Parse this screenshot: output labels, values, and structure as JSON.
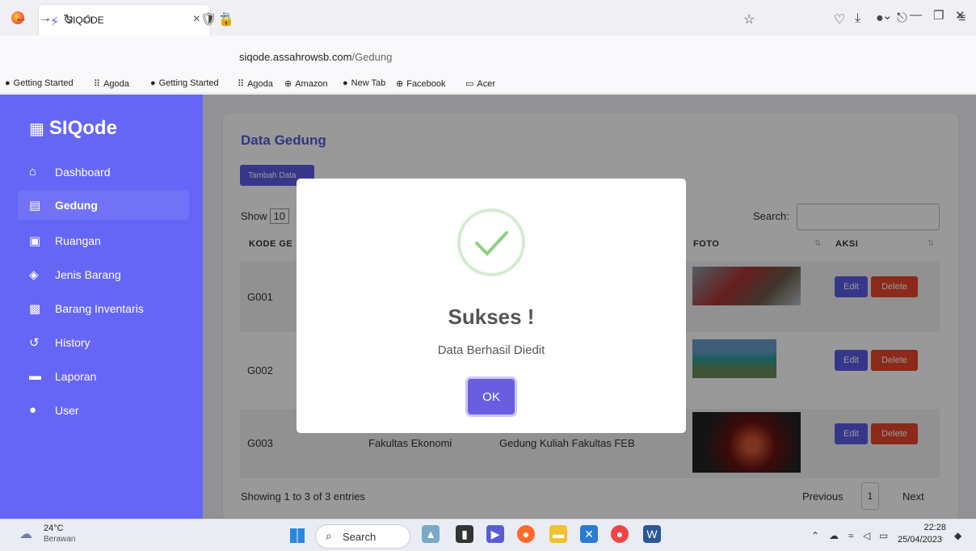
{
  "browser": {
    "tab_title": "SIQODE",
    "tab_close": "×",
    "new_tab": "+",
    "url_host": "siqode.assahrowsb.com",
    "url_path": "/Gedung",
    "bookmarks": [
      "Getting Started",
      "Agoda",
      "Getting Started",
      "Agoda",
      "Amazon",
      "New Tab",
      "Facebook",
      "Acer"
    ]
  },
  "sidebar": {
    "brand": "SIQode",
    "items": [
      {
        "label": "Dashboard",
        "icon": "home-icon"
      },
      {
        "label": "Gedung",
        "icon": "building-icon"
      },
      {
        "label": "Ruangan",
        "icon": "door-icon"
      },
      {
        "label": "Jenis Barang",
        "icon": "box-icon"
      },
      {
        "label": "Barang Inventaris",
        "icon": "boxes-icon"
      },
      {
        "label": "History",
        "icon": "history-icon"
      },
      {
        "label": "Laporan",
        "icon": "pdf-icon"
      },
      {
        "label": "User",
        "icon": "user-icon"
      }
    ]
  },
  "main": {
    "title": "Data Gedung",
    "add_button": "Tambah Data",
    "show_label": "Show",
    "show_value": "10",
    "search_label": "Search:",
    "columns": [
      "KODE GE",
      "FOTO",
      "AKSI"
    ],
    "rows": [
      {
        "kode": "G001",
        "fakultas": "",
        "nama": ""
      },
      {
        "kode": "G002",
        "fakultas": "",
        "nama": ""
      },
      {
        "kode": "G003",
        "fakultas": "Fakultas Ekonomi",
        "nama": "Gedung Kuliah Fakultas FEB"
      }
    ],
    "edit_label": "Edit",
    "delete_label": "Delete",
    "info": "Showing 1 to 3 of 3 entries",
    "prev": "Previous",
    "page": "1",
    "next": "Next"
  },
  "modal": {
    "title": "Sukses !",
    "message": "Data Berhasil Diedit",
    "ok": "OK"
  },
  "taskbar": {
    "temp": "24°C",
    "weather": "Berawan",
    "search": "Search",
    "time": "22:28",
    "date": "25/04/2023"
  },
  "colors": {
    "sidebar": "#6666f6",
    "primary": "#5a5ce8",
    "danger": "#e8452c",
    "success": "#8cd17f"
  }
}
